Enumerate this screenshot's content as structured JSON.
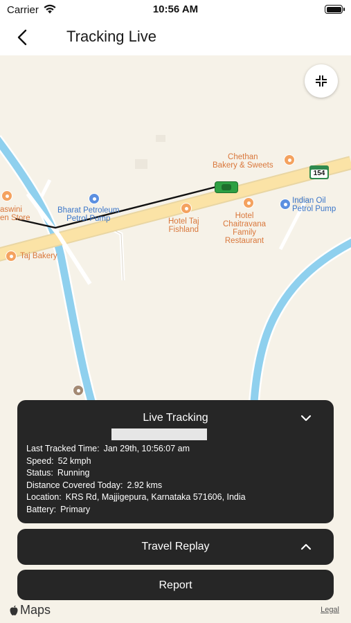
{
  "status_bar": {
    "carrier": "Carrier",
    "time": "10:56 AM"
  },
  "nav": {
    "title": "Tracking Live",
    "back_icon": "chevron-left-icon"
  },
  "map": {
    "collapse_icon": "collapse-arrows-icon",
    "pois": {
      "chethan": "Chethan\nBakery & Sweets",
      "bharat": "Bharat Petroleum\nPetrol Pump",
      "hotel_taj": "Hotel Taj\nFishland",
      "chaitravana": "Hotel\nChaitravana\nFamily\nRestaurant",
      "indian_oil": "Indian Oil\nPetrol Pump",
      "taj_bakery": "Taj Bakery",
      "yaswini": "aswini\nen Store"
    },
    "route_shield": "154",
    "attribution": "Maps",
    "legal": "Legal"
  },
  "live_tracking": {
    "title": "Live Tracking",
    "toggle_icon": "chevron-down-icon",
    "rows": [
      {
        "key": "Last Tracked Time:",
        "value": "Jan 29th, 10:56:07 am"
      },
      {
        "key": "Speed:",
        "value": "52 kmph"
      },
      {
        "key": "Status:",
        "value": "Running"
      },
      {
        "key": "Distance Covered Today:",
        "value": "2.92 kms"
      },
      {
        "key": "Location:",
        "value": "KRS Rd, Majjigepura, Karnataka 571606, India"
      },
      {
        "key": "Battery:",
        "value": "Primary"
      }
    ]
  },
  "travel_replay": {
    "title": "Travel Replay",
    "toggle_icon": "chevron-up-icon"
  },
  "report": {
    "title": "Report"
  },
  "colors": {
    "card_bg": "#262626",
    "map_bg": "#f6f2e8",
    "road": "#fbe3a6",
    "water": "#8fd0ee",
    "vehicle": "#2ea043",
    "poi_orange": "#d9773b",
    "poi_blue": "#3b76c9"
  }
}
